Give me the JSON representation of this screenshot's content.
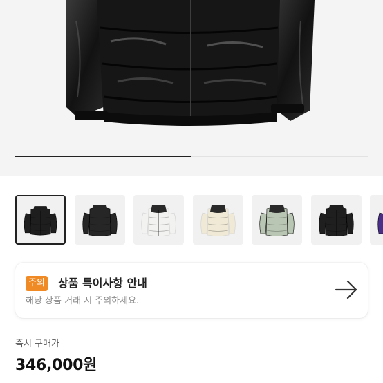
{
  "product": {
    "image_alt": "black puffer down jacket"
  },
  "gallery": {
    "progress": 0.5
  },
  "thumbnails": [
    {
      "name": "shiny-black",
      "color": "#1e1e1e",
      "yoke": "#1e1e1e",
      "selected": true
    },
    {
      "name": "matte-black",
      "color": "#262626",
      "yoke": "#262626",
      "selected": false
    },
    {
      "name": "white",
      "color": "#f2f2f0",
      "yoke": "#2a2a2a",
      "selected": false
    },
    {
      "name": "cream",
      "color": "#efe9d6",
      "yoke": "#2a2a2a",
      "selected": false
    },
    {
      "name": "sage",
      "color": "#b9c6b3",
      "yoke": "#2a2a2a",
      "selected": false
    },
    {
      "name": "black",
      "color": "#1f1f1f",
      "yoke": "#1f1f1f",
      "selected": false
    },
    {
      "name": "purple",
      "color": "#4a2f8a",
      "yoke": "#2a2a2a",
      "selected": false
    }
  ],
  "notice": {
    "badge": "주의",
    "title": "상품 특이사항 안내",
    "subtitle": "해당 상품 거래 시 주의하세요.",
    "badge_color": "#f08a24"
  },
  "price": {
    "label": "즉시 구매가",
    "value": "346,000원"
  }
}
